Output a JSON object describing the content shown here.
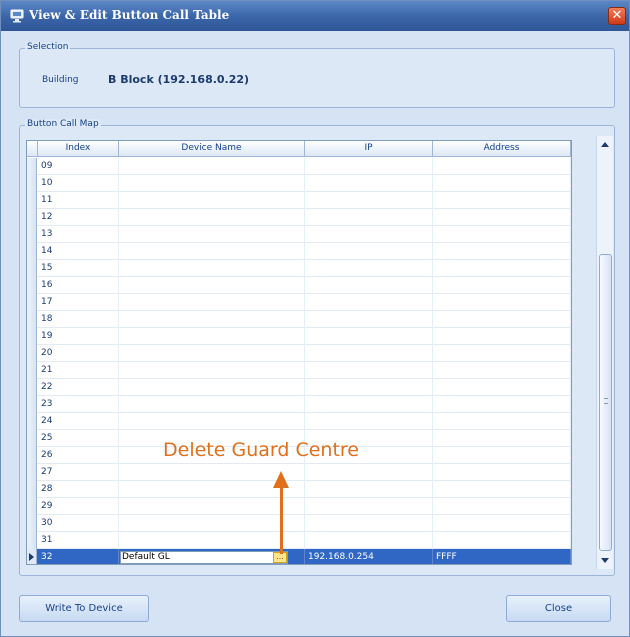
{
  "window": {
    "title": "View & Edit Button Call Table",
    "close_glyph": "✕"
  },
  "selection": {
    "legend": "Selection",
    "building_label": "Building",
    "building_value": "B Block (192.168.0.22)"
  },
  "map": {
    "legend": "Button Call Map",
    "columns": [
      "Index",
      "Device Name",
      "IP",
      "Address"
    ],
    "rows": [
      {
        "index": "09",
        "device": "",
        "ip": "",
        "address": ""
      },
      {
        "index": "10",
        "device": "",
        "ip": "",
        "address": ""
      },
      {
        "index": "11",
        "device": "",
        "ip": "",
        "address": ""
      },
      {
        "index": "12",
        "device": "",
        "ip": "",
        "address": ""
      },
      {
        "index": "13",
        "device": "",
        "ip": "",
        "address": ""
      },
      {
        "index": "14",
        "device": "",
        "ip": "",
        "address": ""
      },
      {
        "index": "15",
        "device": "",
        "ip": "",
        "address": ""
      },
      {
        "index": "16",
        "device": "",
        "ip": "",
        "address": ""
      },
      {
        "index": "17",
        "device": "",
        "ip": "",
        "address": ""
      },
      {
        "index": "18",
        "device": "",
        "ip": "",
        "address": ""
      },
      {
        "index": "19",
        "device": "",
        "ip": "",
        "address": ""
      },
      {
        "index": "20",
        "device": "",
        "ip": "",
        "address": ""
      },
      {
        "index": "21",
        "device": "",
        "ip": "",
        "address": ""
      },
      {
        "index": "22",
        "device": "",
        "ip": "",
        "address": ""
      },
      {
        "index": "23",
        "device": "",
        "ip": "",
        "address": ""
      },
      {
        "index": "24",
        "device": "",
        "ip": "",
        "address": ""
      },
      {
        "index": "25",
        "device": "",
        "ip": "",
        "address": ""
      },
      {
        "index": "26",
        "device": "",
        "ip": "",
        "address": ""
      },
      {
        "index": "27",
        "device": "",
        "ip": "",
        "address": ""
      },
      {
        "index": "28",
        "device": "",
        "ip": "",
        "address": ""
      },
      {
        "index": "29",
        "device": "",
        "ip": "",
        "address": ""
      },
      {
        "index": "30",
        "device": "",
        "ip": "",
        "address": ""
      },
      {
        "index": "31",
        "device": "",
        "ip": "",
        "address": ""
      },
      {
        "index": "32",
        "device": "Default GL",
        "ip": "192.168.0.254",
        "address": "FFFF",
        "selected": true,
        "ellipsis": "..."
      }
    ]
  },
  "buttons": {
    "write": "Write To Device",
    "close": "Close"
  },
  "annotation": {
    "text": "Delete Guard Centre",
    "color": "#e0701c"
  },
  "colors": {
    "selected_row": "#3167c4",
    "title_bar": "#3a64a8"
  },
  "icons": {
    "app": "monitor-icon",
    "close": "close-icon",
    "row_pointer": "row-pointer-icon"
  }
}
